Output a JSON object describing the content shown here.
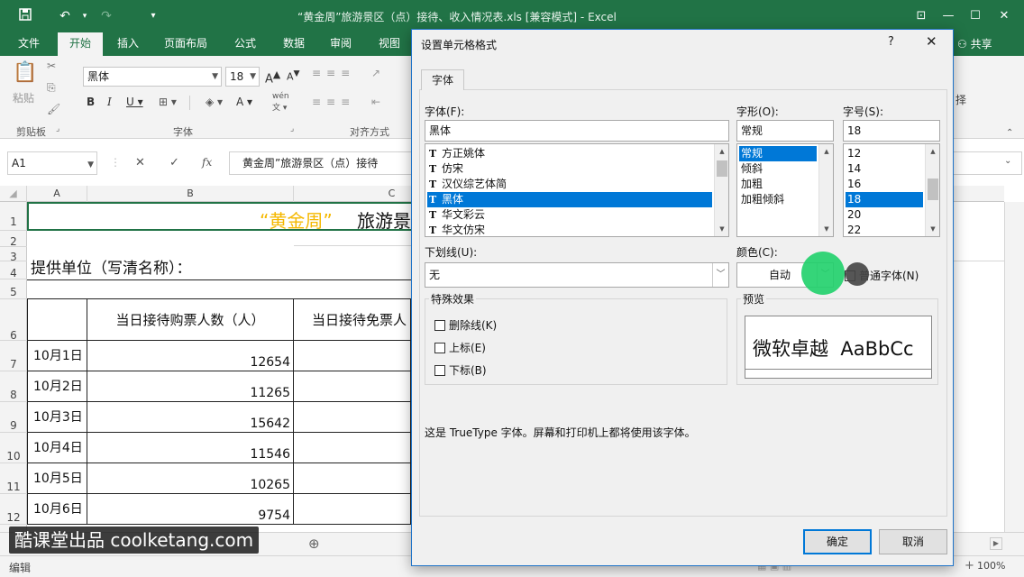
{
  "window": {
    "title": "“黄金周”旅游景区（点）接待、收入情况表.xls  [兼容模式] - Excel",
    "controls": {
      "minimize": "—",
      "restore": "☐",
      "close": "✕",
      "ribbon_opts": "⊡"
    }
  },
  "ribbon": {
    "tabs": [
      "文件",
      "开始",
      "插入",
      "页面布局",
      "公式",
      "数据",
      "审阅",
      "视图"
    ],
    "active_tab": "开始",
    "share_label": "共享",
    "paste_label": "粘贴",
    "clipboard_group": "剪贴板",
    "font_group": "字体",
    "align_group": "对齐方式",
    "font_name": "黑体",
    "font_size": "18",
    "right_label": "择"
  },
  "formula_bar": {
    "name_box": "A1",
    "fx": "fx",
    "formula": "黄金周”旅游景区（点）接待"
  },
  "sheet": {
    "columns": [
      "A",
      "B",
      "C"
    ],
    "rows": [
      "1",
      "2",
      "3",
      "4",
      "5",
      "6",
      "7",
      "8",
      "9",
      "10",
      "11",
      "12"
    ],
    "title_quoted": "“黄金周”",
    "title_rest": "旅游景",
    "provider_label": "提供单位（写清名称）：",
    "header_b": "当日接待购票人数（人）",
    "header_c": "当日接待免票人",
    "data": [
      {
        "date": "10月1日",
        "value": "12654"
      },
      {
        "date": "10月2日",
        "value": "11265"
      },
      {
        "date": "10月3日",
        "value": "15642"
      },
      {
        "date": "10月4日",
        "value": "11546"
      },
      {
        "date": "10月5日",
        "value": "10265"
      },
      {
        "date": "10月6日",
        "value": "9754"
      }
    ]
  },
  "dialog": {
    "title": "设置单元格格式",
    "help": "?",
    "close": "✕",
    "tab": "字体",
    "font_label": "字体(F):",
    "font_value": "黑体",
    "font_list": [
      "方正姚体",
      "仿宋",
      "汉仪综艺体简",
      "黑体",
      "华文彩云",
      "华文仿宋"
    ],
    "font_selected": "黑体",
    "style_label": "字形(O):",
    "style_value": "常规",
    "style_list": [
      "常规",
      "倾斜",
      "加粗",
      "加粗倾斜"
    ],
    "style_selected": "常规",
    "size_label": "字号(S):",
    "size_value": "18",
    "size_list": [
      "12",
      "14",
      "16",
      "18",
      "20",
      "22"
    ],
    "size_selected": "18",
    "underline_label": "下划线(U):",
    "underline_value": "无",
    "color_label": "颜色(C):",
    "color_value": "自动",
    "normal_font_label": "普通字体(N)",
    "effects_label": "特殊效果",
    "effects": [
      "删除线(K)",
      "上标(E)",
      "下标(B)"
    ],
    "preview_label": "预览",
    "preview_text": "微软卓越  AaBbCc",
    "info": "这是 TrueType 字体。屏幕和打印机上都将使用该字体。",
    "ok": "确定",
    "cancel": "取消"
  },
  "statusbar": {
    "mode": "编辑",
    "zoom": "100%",
    "zoom_minus": "−",
    "zoom_plus": "+"
  },
  "watermark": "酷课堂出品 coolketang.com",
  "colors": {
    "excel_green": "#217346",
    "title_gold": "#f5b800",
    "selection_blue": "#0078d7"
  }
}
